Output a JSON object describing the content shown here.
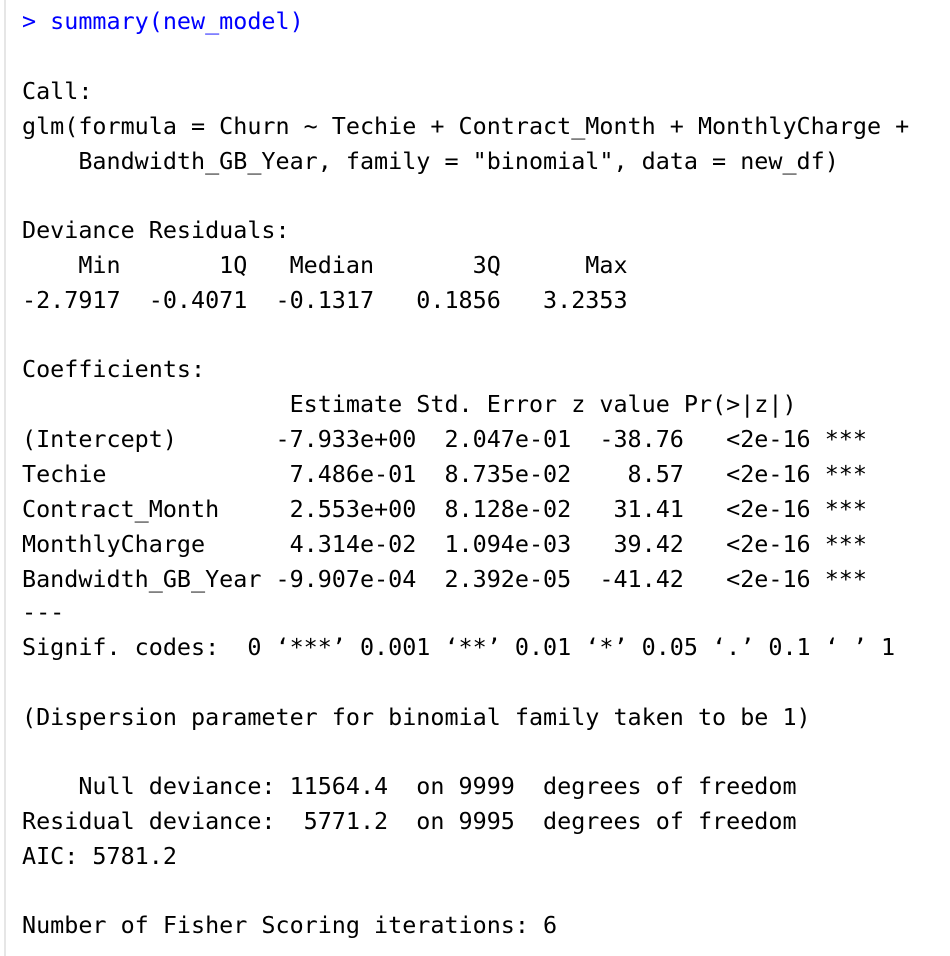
{
  "command": "> summary(new_model)",
  "call_header": "Call:",
  "call_line1": "glm(formula = Churn ~ Techie + Contract_Month + MonthlyCharge +",
  "call_line2": "    Bandwidth_GB_Year, family = \"binomial\", data = new_df)",
  "deviance_residuals": {
    "header": "Deviance Residuals:",
    "labels_line": "    Min       1Q   Median       3Q      Max  ",
    "values_line": "-2.7917  -0.4071  -0.1317   0.1856   3.2353  "
  },
  "coefficients": {
    "header": "Coefficients:",
    "col_header": "                   Estimate Std. Error z value Pr(>|z|)    ",
    "rows": [
      "(Intercept)       -7.933e+00  2.047e-01  -38.76   <2e-16 ***",
      "Techie             7.486e-01  8.735e-02    8.57   <2e-16 ***",
      "Contract_Month     2.553e+00  8.128e-02   31.41   <2e-16 ***",
      "MonthlyCharge      4.314e-02  1.094e-03   39.42   <2e-16 ***",
      "Bandwidth_GB_Year -9.907e-04  2.392e-05  -41.42   <2e-16 ***"
    ],
    "separator": "---",
    "signif": "Signif. codes:  0 ‘***’ 0.001 ‘**’ 0.01 ‘*’ 0.05 ‘.’ 0.1 ‘ ’ 1"
  },
  "dispersion": "(Dispersion parameter for binomial family taken to be 1)",
  "null_deviance": "    Null deviance: 11564.4  on 9999  degrees of freedom",
  "residual_deviance": "Residual deviance:  5771.2  on 9995  degrees of freedom",
  "aic": "AIC: 5781.2",
  "fisher": "Number of Fisher Scoring iterations: 6",
  "colors": {
    "prompt": "#0000ff",
    "text": "#000000",
    "background": "#ffffff"
  }
}
